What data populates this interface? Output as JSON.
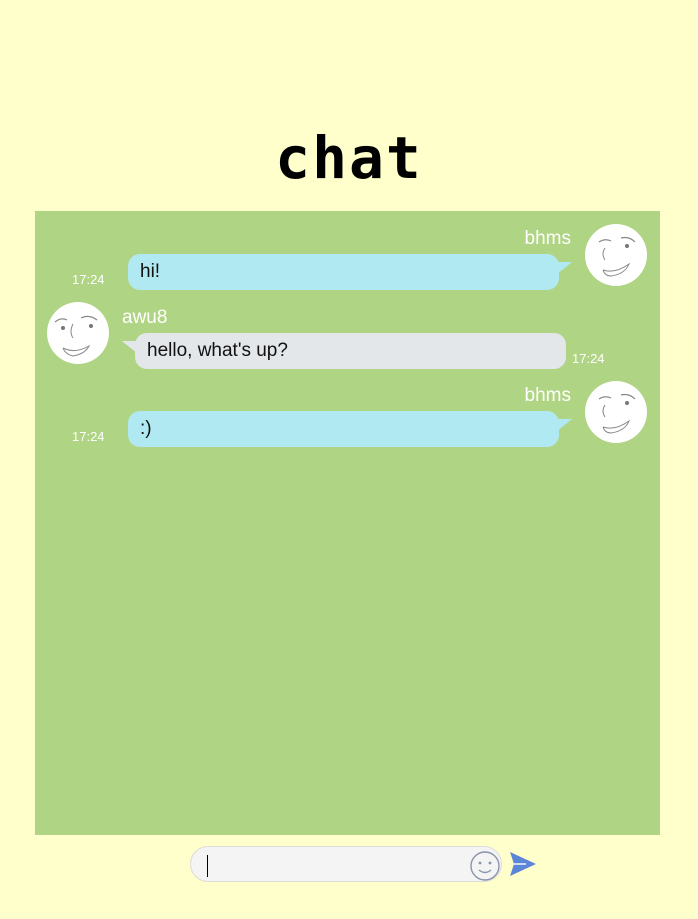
{
  "header": {
    "title": "chat"
  },
  "messages": [
    {
      "user": "bhms",
      "text": "hi!",
      "time": "17:24",
      "side": "right"
    },
    {
      "user": "awu8",
      "text": "hello, what's up?",
      "time": "17:24",
      "side": "left"
    },
    {
      "user": "bhms",
      "text": ":)",
      "time": "17:24",
      "side": "right"
    }
  ],
  "composer": {
    "value": "",
    "placeholder": ""
  },
  "colors": {
    "page_bg": "#ffffcc",
    "chat_bg": "#afd483",
    "my_bubble": "#b0e9f2",
    "other_bubble": "#e3e7ea",
    "send_icon": "#5b86d8"
  },
  "icons": {
    "emoji": "smiley-face-icon",
    "send": "paper-plane-icon",
    "avatar": "face-sketch-icon"
  }
}
